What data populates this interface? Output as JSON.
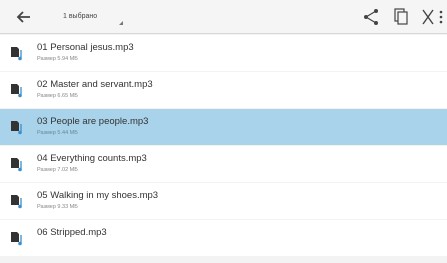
{
  "toolbar": {
    "back_icon": "arrow-left-icon",
    "selection_count": "1 выбрано",
    "share_icon": "share-icon",
    "copy_icon": "copy-icon",
    "cut_icon": "cut-icon",
    "more_icon": "more-vert-icon"
  },
  "files": [
    {
      "name": "01 Personal jesus.mp3",
      "size": "Размер 5.94 МБ",
      "selected": false
    },
    {
      "name": "02 Master and servant.mp3",
      "size": "Размер 6.65 МБ",
      "selected": false
    },
    {
      "name": "03 People are people.mp3",
      "size": "Размер 5.44 МБ",
      "selected": true
    },
    {
      "name": "04 Everything counts.mp3",
      "size": "Размер 7.02 МБ",
      "selected": false
    },
    {
      "name": "05 Walking in my shoes.mp3",
      "size": "Размер 9.33 МБ",
      "selected": false
    },
    {
      "name": "06 Stripped.mp3",
      "size": "",
      "selected": false
    }
  ],
  "colors": {
    "selected_row": "#a9d3ea",
    "toolbar_bg": "#f5f5f5",
    "icon_dark": "#333333",
    "icon_accent": "#3a8fd0"
  }
}
